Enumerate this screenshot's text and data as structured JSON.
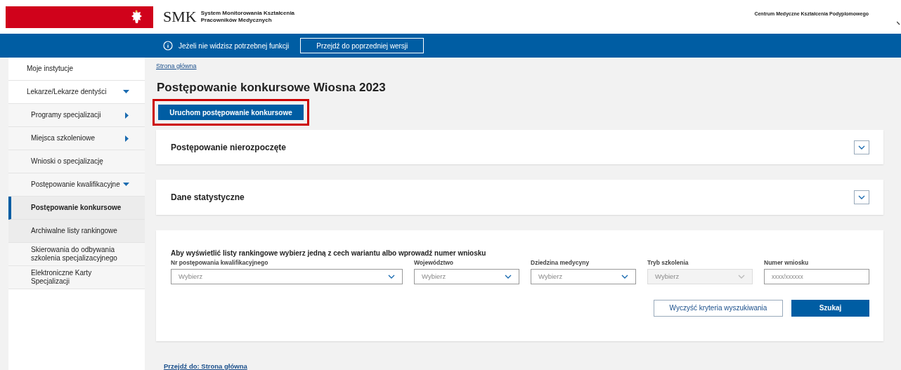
{
  "header": {
    "logo_text": "SMK",
    "system_name": [
      "System Monitorowania Kształcenia",
      "Pracowników Medycznych"
    ],
    "institution": "Centrum Medyczne Kształcenia Podyplomowego"
  },
  "notice_bar": {
    "text": "Jeżeli nie widzisz potrzebnej funkcji",
    "button": "Przejdź do poprzedniej wersji"
  },
  "sidebar": {
    "items": [
      {
        "label": "Moje instytucje",
        "selected": false
      },
      {
        "label": "Lekarze/Lekarze dentyści",
        "selected": false,
        "expanded": true,
        "children": [
          {
            "label": "Programy specjalizacji",
            "selected": false,
            "expanded": false
          },
          {
            "label": "Miejsca szkoleniowe",
            "selected": false,
            "expanded": false
          },
          {
            "label": "Wnioski o specjalizację",
            "selected": false
          },
          {
            "label": "Postępowanie kwalifikacyjne",
            "selected": false,
            "expanded": true,
            "children": [
              {
                "label": "Postępowanie konkursowe",
                "selected": true
              },
              {
                "label": "Archiwalne listy rankingowe",
                "selected": false
              }
            ]
          },
          {
            "label": "Skierowania do odbywania szkolenia specjalizacyjnego",
            "selected": false
          },
          {
            "label": "Elektroniczne Karty Specjalizacji",
            "selected": false
          }
        ]
      }
    ]
  },
  "breadcrumb": "Strona główna",
  "page_title": "Postępowanie konkursowe Wiosna 2023",
  "primary_button": {
    "label": "Uruchom postępowanie konkursowe",
    "highlighted": true
  },
  "panels": [
    {
      "title": "Postępowanie nierozpoczęte",
      "expanded": false
    },
    {
      "title": "Dane statystyczne",
      "expanded": false
    }
  ],
  "search": {
    "instruction": "Aby wyświetlić listy rankingowe wybierz jedną z cech wariantu albo wprowadź numer wniosku",
    "fields": [
      {
        "kind": "select",
        "label": "Nr postępowania kwalifikacyjnego",
        "placeholder": "Wybierz",
        "disabled": false
      },
      {
        "kind": "select",
        "label": "Województwo",
        "placeholder": "Wybierz",
        "disabled": false
      },
      {
        "kind": "select",
        "label": "Dziedzina medycyny",
        "placeholder": "Wybierz",
        "disabled": false
      },
      {
        "kind": "select",
        "label": "Tryb szkolenia",
        "placeholder": "Wybierz",
        "disabled": true
      },
      {
        "kind": "input",
        "label": "Numer wniosku",
        "placeholder": "xxxx/xxxxxx",
        "disabled": false
      }
    ],
    "clear_button": "Wyczyść kryteria wyszukiwania",
    "search_button": "Szukaj"
  },
  "footer_link": "Przejdź do: Strona główna"
}
